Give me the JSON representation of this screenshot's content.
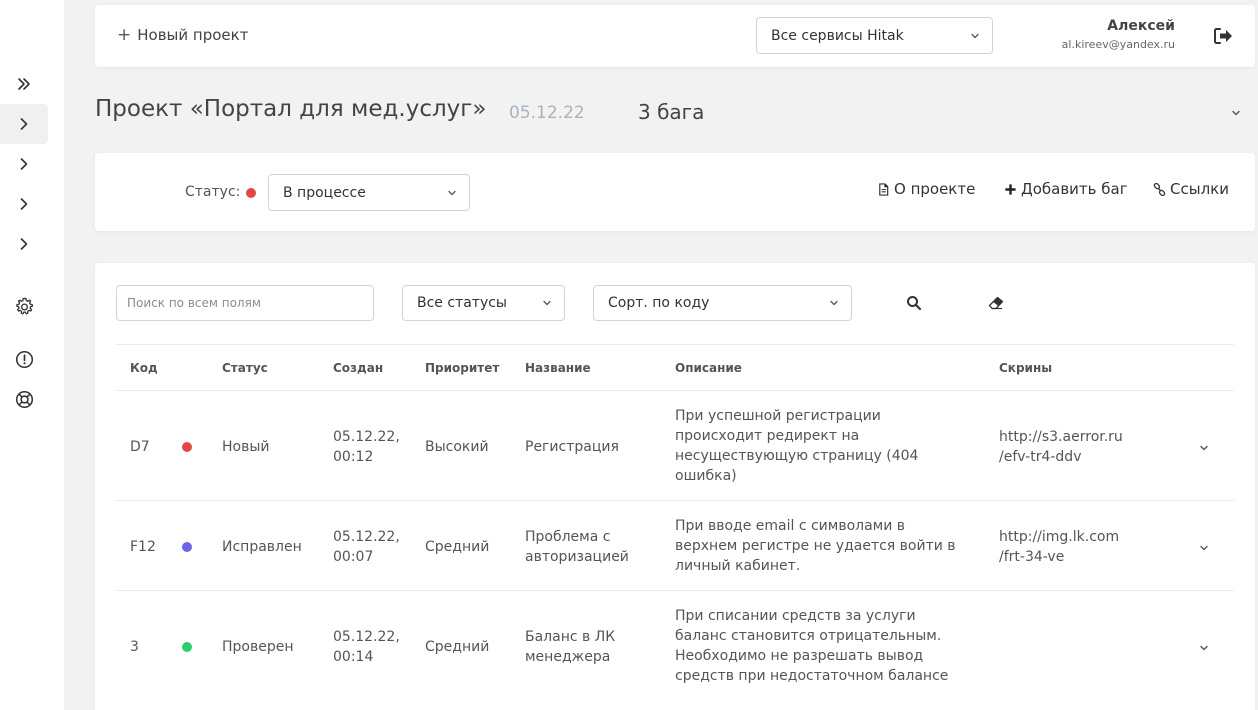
{
  "sidebar": {
    "items": [
      {
        "icon": "double-chevron-right-icon"
      },
      {
        "icon": "chevron-right-icon"
      },
      {
        "icon": "chevron-right-icon"
      },
      {
        "icon": "chevron-right-icon"
      },
      {
        "icon": "chevron-right-icon"
      },
      {
        "icon": "gear-icon"
      },
      {
        "icon": "alert-circle-icon"
      },
      {
        "icon": "lifebuoy-icon"
      }
    ]
  },
  "topbar": {
    "new_project": "Новый проект",
    "services_select": "Все сервисы Hitak",
    "user_name": "Алексей",
    "user_email": "al.kireev@yandex.ru"
  },
  "project": {
    "title": "Проект «Портал для мед.услуг»",
    "date": "05.12.22",
    "bug_count": "3 бага"
  },
  "status_panel": {
    "label": "Статус:",
    "status_value": "В процессе",
    "status_color": "#e04848",
    "about": "О проекте",
    "add_bug": "Добавить баг",
    "links": "Ссылки"
  },
  "filters": {
    "search_placeholder": "Поиск по всем полям",
    "status_filter": "Все статусы",
    "sort": "Сорт. по коду"
  },
  "table": {
    "headers": {
      "code": "Код",
      "status": "Статус",
      "created": "Создан",
      "priority": "Приоритет",
      "name": "Название",
      "description": "Описание",
      "screens": "Скрины"
    },
    "rows": [
      {
        "code": "D7",
        "status": "Новый",
        "status_color": "#e04848",
        "created_date": "05.12.22,",
        "created_time": "00:12",
        "priority": "Высокий",
        "name_1": "Регистрация",
        "name_2": "",
        "desc_1": "При успешной регистрации",
        "desc_2": "происходит редирект на",
        "desc_3": "несуществующую страницу (404",
        "desc_4": "ошибка)",
        "screen_1": "http://s3.aerror.ru",
        "screen_2": "/efv-tr4-ddv"
      },
      {
        "code": "F12",
        "status": "Исправлен",
        "status_color": "#6e64e8",
        "created_date": "05.12.22,",
        "created_time": "00:07",
        "priority": "Средний",
        "name_1": "Проблема с",
        "name_2": "авторизацией",
        "desc_1": "При вводе email с символами в",
        "desc_2": "верхнем регистре не удается войти в",
        "desc_3": "личный кабинет.",
        "desc_4": "",
        "screen_1": "http://img.lk.com",
        "screen_2": "/frt-34-ve"
      },
      {
        "code": "3",
        "status": "Проверен",
        "status_color": "#2ecc71",
        "created_date": "05.12.22,",
        "created_time": "00:14",
        "priority": "Средний",
        "name_1": "Баланс в ЛК",
        "name_2": "менеджера",
        "desc_1": "При списании средств за услуги",
        "desc_2": "баланс становится отрицательным.",
        "desc_3": "Необходимо не разрешать вывод",
        "desc_4": "средств при недостаточном балансе",
        "screen_1": "",
        "screen_2": ""
      }
    ]
  }
}
